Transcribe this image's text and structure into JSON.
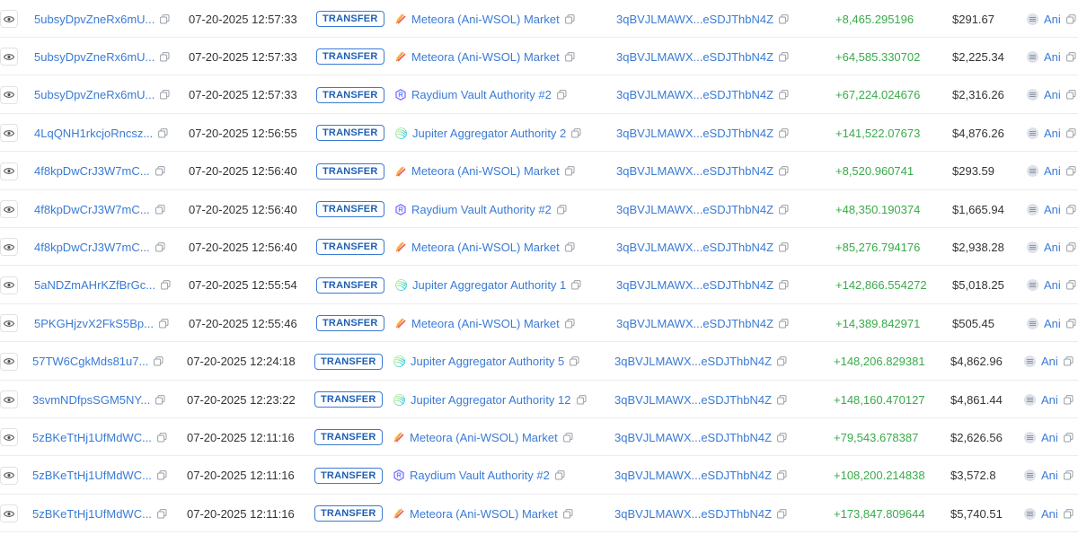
{
  "colors": {
    "link": "#3a7bd5",
    "amount_positive": "#3aaa4a",
    "badge_border": "#3a7bd5"
  },
  "rows": [
    {
      "signature": "5ubsyDpvZneRx6mU...",
      "time": "07-20-2025 12:57:33",
      "action": "TRANSFER",
      "market_icon": "meteora-icon",
      "market": "Meteora (Ani-WSOL) Market",
      "address": "3qBVJLMAWX...eSDJThbN4Z",
      "amount": "+8,465.295196",
      "value": "$291.67",
      "token": "Ani"
    },
    {
      "signature": "5ubsyDpvZneRx6mU...",
      "time": "07-20-2025 12:57:33",
      "action": "TRANSFER",
      "market_icon": "meteora-icon",
      "market": "Meteora (Ani-WSOL) Market",
      "address": "3qBVJLMAWX...eSDJThbN4Z",
      "amount": "+64,585.330702",
      "value": "$2,225.34",
      "token": "Ani"
    },
    {
      "signature": "5ubsyDpvZneRx6mU...",
      "time": "07-20-2025 12:57:33",
      "action": "TRANSFER",
      "market_icon": "raydium-icon",
      "market": "Raydium Vault Authority #2",
      "address": "3qBVJLMAWX...eSDJThbN4Z",
      "amount": "+67,224.024676",
      "value": "$2,316.26",
      "token": "Ani"
    },
    {
      "signature": "4LqQNH1rkcjoRncsz...",
      "time": "07-20-2025 12:56:55",
      "action": "TRANSFER",
      "market_icon": "jupiter-icon",
      "market": "Jupiter Aggregator Authority 2",
      "address": "3qBVJLMAWX...eSDJThbN4Z",
      "amount": "+141,522.07673",
      "value": "$4,876.26",
      "token": "Ani"
    },
    {
      "signature": "4f8kpDwCrJ3W7mC...",
      "time": "07-20-2025 12:56:40",
      "action": "TRANSFER",
      "market_icon": "meteora-icon",
      "market": "Meteora (Ani-WSOL) Market",
      "address": "3qBVJLMAWX...eSDJThbN4Z",
      "amount": "+8,520.960741",
      "value": "$293.59",
      "token": "Ani"
    },
    {
      "signature": "4f8kpDwCrJ3W7mC...",
      "time": "07-20-2025 12:56:40",
      "action": "TRANSFER",
      "market_icon": "raydium-icon",
      "market": "Raydium Vault Authority #2",
      "address": "3qBVJLMAWX...eSDJThbN4Z",
      "amount": "+48,350.190374",
      "value": "$1,665.94",
      "token": "Ani"
    },
    {
      "signature": "4f8kpDwCrJ3W7mC...",
      "time": "07-20-2025 12:56:40",
      "action": "TRANSFER",
      "market_icon": "meteora-icon",
      "market": "Meteora (Ani-WSOL) Market",
      "address": "3qBVJLMAWX...eSDJThbN4Z",
      "amount": "+85,276.794176",
      "value": "$2,938.28",
      "token": "Ani"
    },
    {
      "signature": "5aNDZmAHrKZfBrGc...",
      "time": "07-20-2025 12:55:54",
      "action": "TRANSFER",
      "market_icon": "jupiter-icon",
      "market": "Jupiter Aggregator Authority 1",
      "address": "3qBVJLMAWX...eSDJThbN4Z",
      "amount": "+142,866.554272",
      "value": "$5,018.25",
      "token": "Ani"
    },
    {
      "signature": "5PKGHjzvX2FkS5Bp...",
      "time": "07-20-2025 12:55:46",
      "action": "TRANSFER",
      "market_icon": "meteora-icon",
      "market": "Meteora (Ani-WSOL) Market",
      "address": "3qBVJLMAWX...eSDJThbN4Z",
      "amount": "+14,389.842971",
      "value": "$505.45",
      "token": "Ani"
    },
    {
      "signature": "57TW6CgkMds81u7...",
      "time": "07-20-2025 12:24:18",
      "action": "TRANSFER",
      "market_icon": "jupiter-icon",
      "market": "Jupiter Aggregator Authority 5",
      "address": "3qBVJLMAWX...eSDJThbN4Z",
      "amount": "+148,206.829381",
      "value": "$4,862.96",
      "token": "Ani"
    },
    {
      "signature": "3svmNDfpsSGM5NY...",
      "time": "07-20-2025 12:23:22",
      "action": "TRANSFER",
      "market_icon": "jupiter-icon",
      "market": "Jupiter Aggregator Authority 12",
      "address": "3qBVJLMAWX...eSDJThbN4Z",
      "amount": "+148,160.470127",
      "value": "$4,861.44",
      "token": "Ani"
    },
    {
      "signature": "5zBKeTtHj1UfMdWC...",
      "time": "07-20-2025 12:11:16",
      "action": "TRANSFER",
      "market_icon": "meteora-icon",
      "market": "Meteora (Ani-WSOL) Market",
      "address": "3qBVJLMAWX...eSDJThbN4Z",
      "amount": "+79,543.678387",
      "value": "$2,626.56",
      "token": "Ani"
    },
    {
      "signature": "5zBKeTtHj1UfMdWC...",
      "time": "07-20-2025 12:11:16",
      "action": "TRANSFER",
      "market_icon": "raydium-icon",
      "market": "Raydium Vault Authority #2",
      "address": "3qBVJLMAWX...eSDJThbN4Z",
      "amount": "+108,200.214838",
      "value": "$3,572.8",
      "token": "Ani"
    },
    {
      "signature": "5zBKeTtHj1UfMdWC...",
      "time": "07-20-2025 12:11:16",
      "action": "TRANSFER",
      "market_icon": "meteora-icon",
      "market": "Meteora (Ani-WSOL) Market",
      "address": "3qBVJLMAWX...eSDJThbN4Z",
      "amount": "+173,847.809644",
      "value": "$5,740.51",
      "token": "Ani"
    }
  ]
}
